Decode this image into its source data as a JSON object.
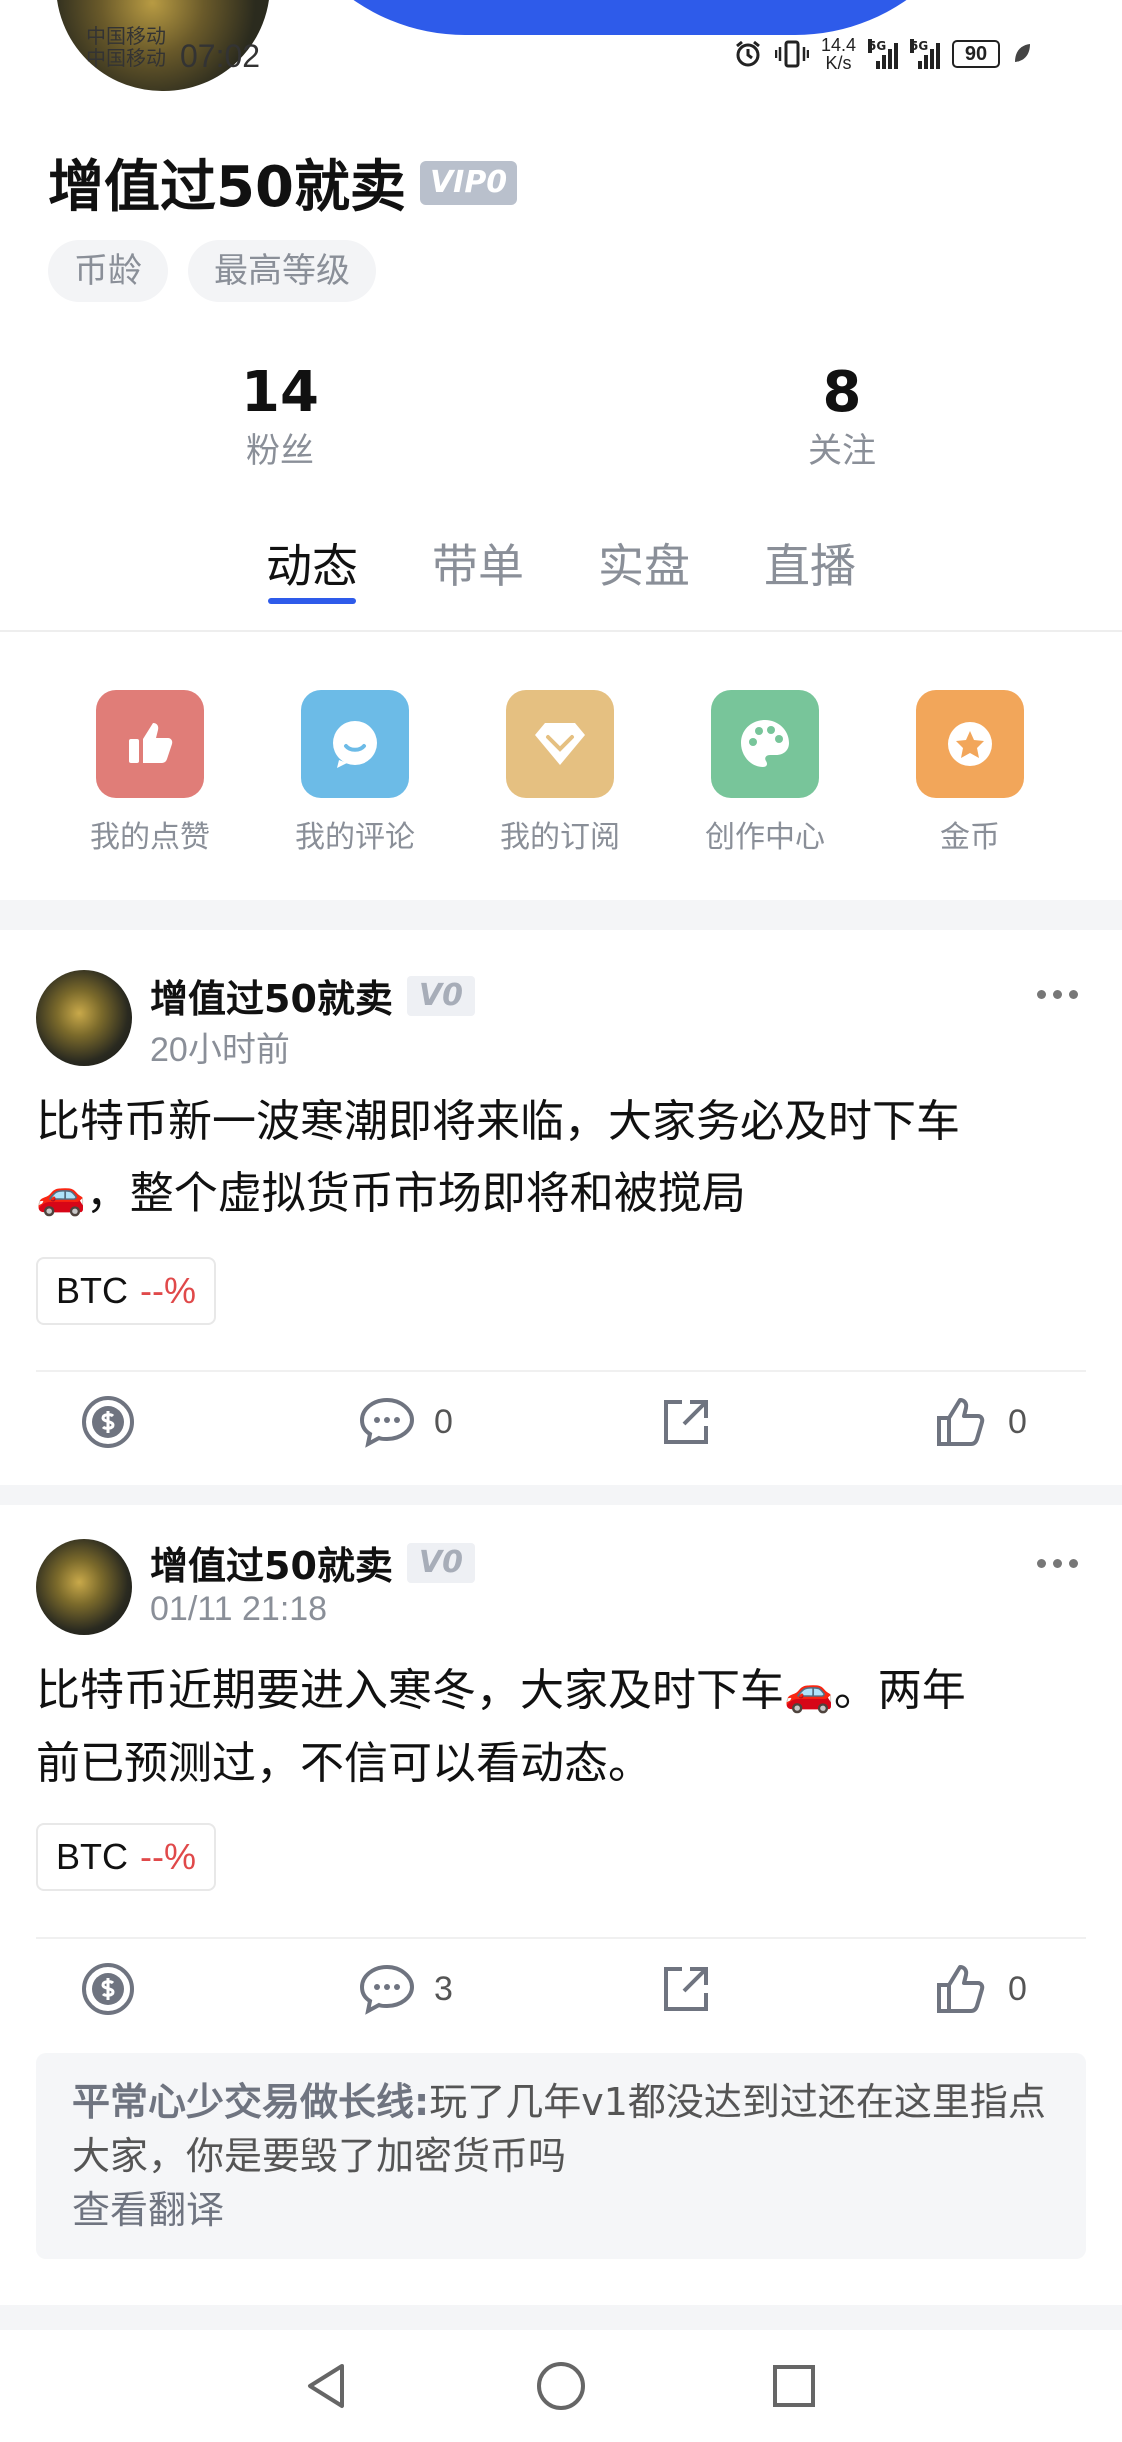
{
  "status_bar": {
    "carrier_line1": "中国移动",
    "carrier_line2": "中国移动",
    "time": "07:02",
    "net_speed_value": "14.4",
    "net_speed_unit": "K/s",
    "sim1_type": "5G",
    "sim2_type": "5G",
    "battery": "90"
  },
  "profile": {
    "name": "增值过50就卖",
    "vip_badge": "VIP0",
    "tags": [
      "币龄",
      "最高等级"
    ],
    "followers_count": "14",
    "followers_label": "粉丝",
    "following_count": "8",
    "following_label": "关注"
  },
  "tabs": [
    {
      "label": "动态",
      "active": true
    },
    {
      "label": "带单",
      "active": false
    },
    {
      "label": "实盘",
      "active": false
    },
    {
      "label": "直播",
      "active": false
    }
  ],
  "colors": {
    "accent": "#2e5bea",
    "likes_icon_bg": "#e07d78",
    "comments_icon_bg": "#6cbbe7",
    "subscriptions_icon_bg": "#e5c081",
    "creation_icon_bg": "#78c59a",
    "coins_icon_bg": "#f2a65a",
    "negative": "#e0494a"
  },
  "quick_actions": [
    {
      "label": "我的点赞",
      "icon": "thumbs-up-icon"
    },
    {
      "label": "我的评论",
      "icon": "chat-bubble-icon"
    },
    {
      "label": "我的订阅",
      "icon": "diamond-icon"
    },
    {
      "label": "创作中心",
      "icon": "palette-icon"
    },
    {
      "label": "金币",
      "icon": "star-coin-icon"
    }
  ],
  "posts": [
    {
      "author": "增值过50就卖",
      "badge": "V0",
      "time": "20小时前",
      "text_line1": "比特币新一波寒潮即将来临，大家务必及时下车",
      "text_line2": "，整个虚拟货币市场即将和被搅局",
      "coin": "BTC",
      "change": "--%",
      "comments": "0",
      "likes": "0"
    },
    {
      "author": "增值过50就卖",
      "badge": "V0",
      "time": "01/11 21:18",
      "text_line1_a": "比特币近期要进入寒冬，大家及时下车",
      "text_line1_b": "。两年",
      "text_line2": "前已预测过，不信可以看动态。",
      "coin": "BTC",
      "change": "--%",
      "comments": "3",
      "likes": "0",
      "comment_preview": {
        "author": "平常心少交易做长线:",
        "text": "玩了几年v1都没达到过还在这里指点大家，你是要毁了加密货币吗",
        "translate": "查看翻译"
      }
    }
  ]
}
